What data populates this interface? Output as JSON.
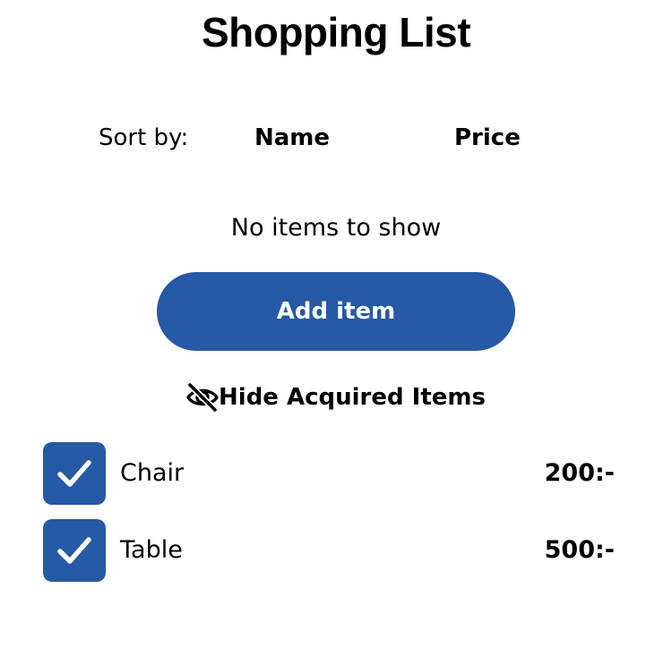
{
  "header": {
    "title": "Shopping List"
  },
  "sort": {
    "label": "Sort by:",
    "options": [
      {
        "label": "Name"
      },
      {
        "label": "Price"
      }
    ]
  },
  "list": {
    "empty_message": "No items to show"
  },
  "actions": {
    "add_label": "Add item",
    "hide_label": "Hide Acquired Items",
    "hide_icon": "eye-slash-icon"
  },
  "acquired_items": [
    {
      "name": "Chair",
      "price": "200:-",
      "checked": true,
      "check_icon": "checkmark-icon"
    },
    {
      "name": "Table",
      "price": "500:-",
      "checked": true,
      "check_icon": "checkmark-icon"
    }
  ],
  "colors": {
    "accent": "#2659a6",
    "text": "#000000",
    "background": "#ffffff",
    "on_accent": "#ffffff"
  }
}
